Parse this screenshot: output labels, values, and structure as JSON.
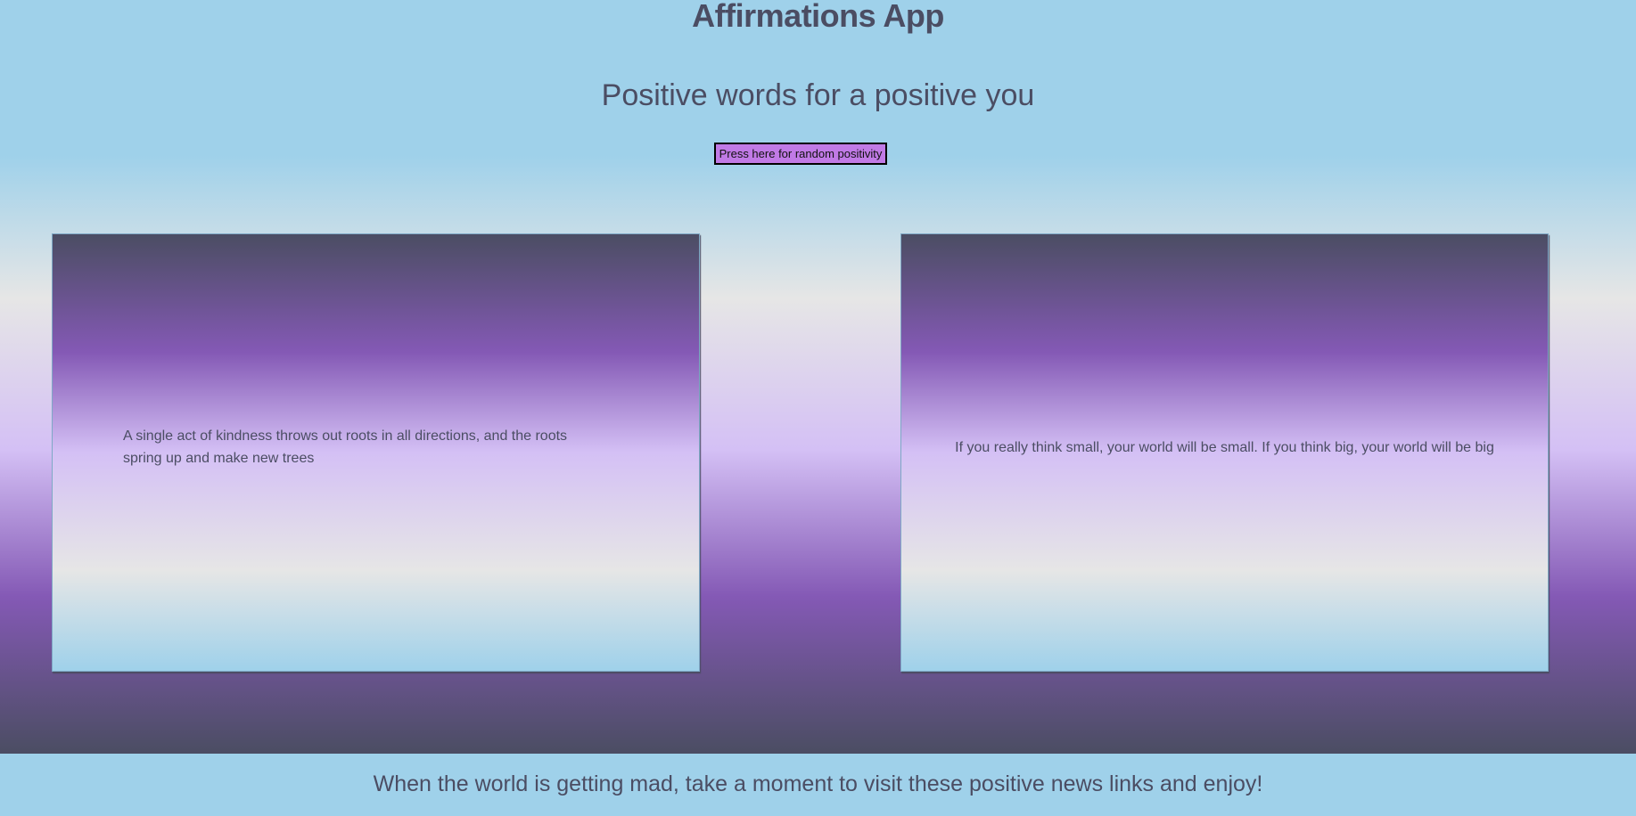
{
  "header": {
    "title": "Affirmations App",
    "subtitle": "Positive words for a positive you",
    "button_label": "Press here for random positivity"
  },
  "cards": [
    {
      "text": "A single act of kindness throws out roots in all directions, and the roots spring up and make new trees"
    },
    {
      "text": "If you really think small, your world will be small. If you think big, your world will be big"
    }
  ],
  "footer": {
    "text": "When the world is getting mad, take a moment to visit these positive news links and enjoy!"
  },
  "colors": {
    "sky_blue": "#9fd1ea",
    "purple": "#8459b5",
    "lavender": "#d4c0f5",
    "slate": "#4b4d63",
    "button": "#c17ae6"
  }
}
